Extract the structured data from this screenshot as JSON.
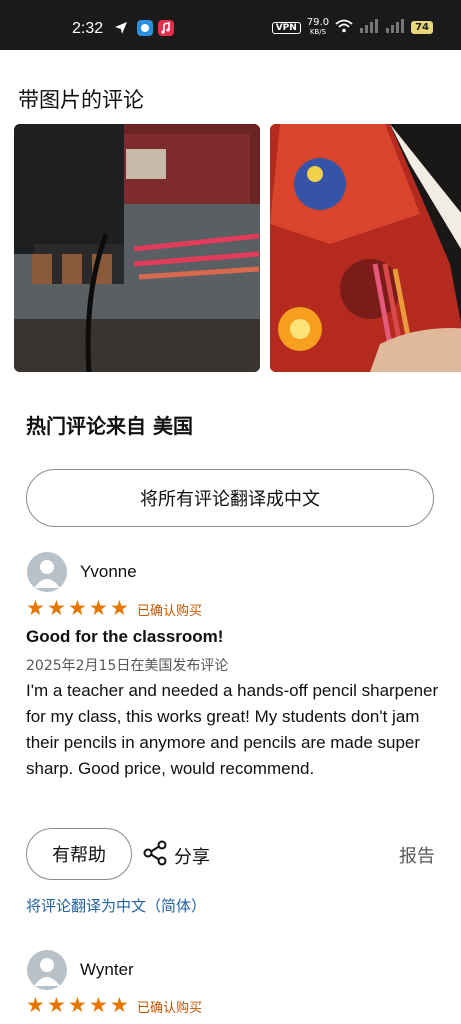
{
  "status_bar": {
    "time": "2:32",
    "vpn": "VPN",
    "speed_value": "79.0",
    "speed_unit": "KB/S",
    "battery": "74"
  },
  "photos_section": {
    "title": "带图片的评论"
  },
  "top_reviews": {
    "title": "热门评论来自 美国",
    "translate_all_label": "将所有评论翻译成中文"
  },
  "reviews": [
    {
      "name": "Yvonne",
      "rating": 5,
      "verified": "已确认购买",
      "title": "Good for the classroom!",
      "date": "2025年2月15日在美国发布评论",
      "body": "I'm a teacher and needed a hands-off pencil sharpener for my class, this works great! My students don't jam their pencils in anymore and pencils are made super sharp. Good price, would recommend.",
      "helpful_label": "有帮助",
      "share_label": "分享",
      "report_label": "报告",
      "translate_label": "将评论翻译为中文（简体）"
    },
    {
      "name": "Wynter",
      "rating": 5,
      "verified": "已确认购买"
    }
  ],
  "colors": {
    "star": "#e77600",
    "verified": "#c45500",
    "link": "#2162a1"
  }
}
